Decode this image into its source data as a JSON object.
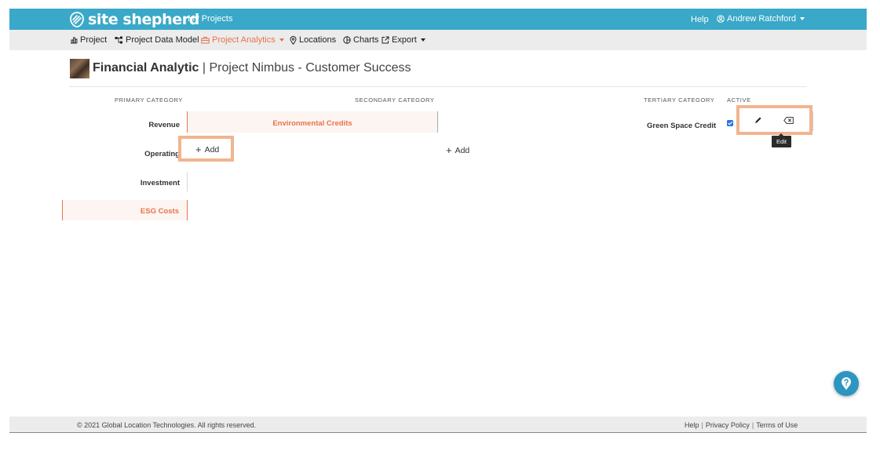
{
  "brand": {
    "name": "site shepherd"
  },
  "topbar": {
    "my_projects": "My Projects",
    "help": "Help",
    "user": "Andrew Ratchford"
  },
  "menu": {
    "project": "Project",
    "data_model": "Project Data Model",
    "analytics": "Project Analytics",
    "locations": "Locations",
    "charts": "Charts",
    "export": "Export"
  },
  "page": {
    "title_bold": "Financial Analytic",
    "title_rest": "| Project Nimbus - Customer Success"
  },
  "columns": {
    "primary": "PRIMARY CATEGORY",
    "secondary": "SECONDARY CATEGORY",
    "tertiary": "TERTIARY CATEGORY",
    "active": "ACTIVE"
  },
  "primary": [
    "Revenue",
    "Operating",
    "Investment",
    "ESG Costs"
  ],
  "secondary": {
    "selected": "Environmental Credits"
  },
  "tertiary": {
    "item": "Green Space Credit",
    "active": true
  },
  "add_label": "Add",
  "tooltip": "Edit",
  "footer": {
    "copyright": "© 2021 Global Location Technologies. All rights reserved.",
    "help": "Help",
    "privacy": "Privacy Policy",
    "terms": "Terms of Use"
  },
  "colors": {
    "brand": "#3aa8c8",
    "accent": "#e8734a",
    "highlight": "#f1b58f"
  }
}
